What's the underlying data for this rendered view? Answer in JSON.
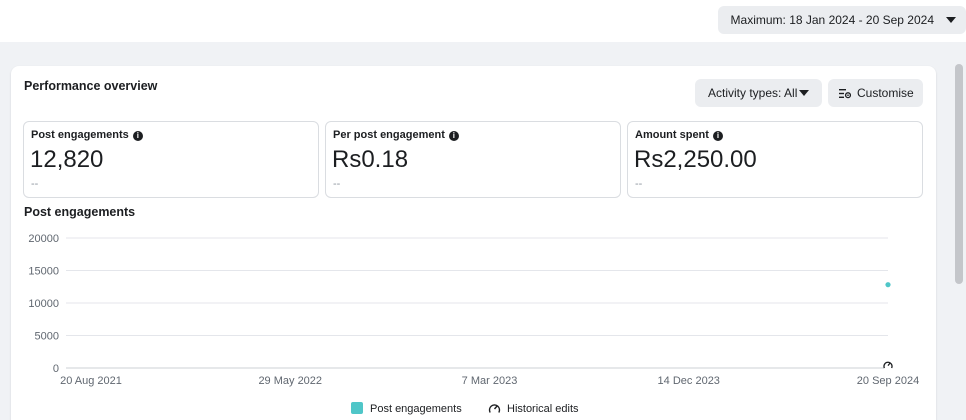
{
  "topbar": {
    "date_range": "Maximum: 18 Jan 2024 - 20 Sep 2024"
  },
  "card": {
    "title": "Performance overview",
    "activity_button": "Activity types: All",
    "customise_button": "Customise"
  },
  "metrics": [
    {
      "label": "Post engagements",
      "value": "12,820",
      "sub": "--"
    },
    {
      "label": "Per post engagement",
      "value": "Rs0.18",
      "sub": "--"
    },
    {
      "label": "Amount spent",
      "value": "Rs2,250.00",
      "sub": "--"
    }
  ],
  "chart_title": "Post engagements",
  "legend": {
    "engagements": "Post engagements",
    "edits": "Historical edits"
  },
  "colors": {
    "series": "#4fc6c8",
    "grid": "#e4e6eb",
    "axis_text": "#606770"
  },
  "chart_data": {
    "type": "scatter",
    "title": "Post engagements",
    "xlabel": "",
    "ylabel": "",
    "x_ticks": [
      "20 Aug 2021",
      "29 May 2022",
      "7 Mar 2023",
      "14 Dec 2023",
      "20 Sep 2024"
    ],
    "y_ticks": [
      0,
      5000,
      10000,
      15000,
      20000
    ],
    "ylim": [
      0,
      20000
    ],
    "series": [
      {
        "name": "Post engagements",
        "points": [
          {
            "x": "20 Sep 2024",
            "y": 12820
          }
        ]
      }
    ],
    "historical_edits": [
      {
        "x": "20 Sep 2024"
      }
    ],
    "grid": true,
    "legend_position": "bottom"
  }
}
